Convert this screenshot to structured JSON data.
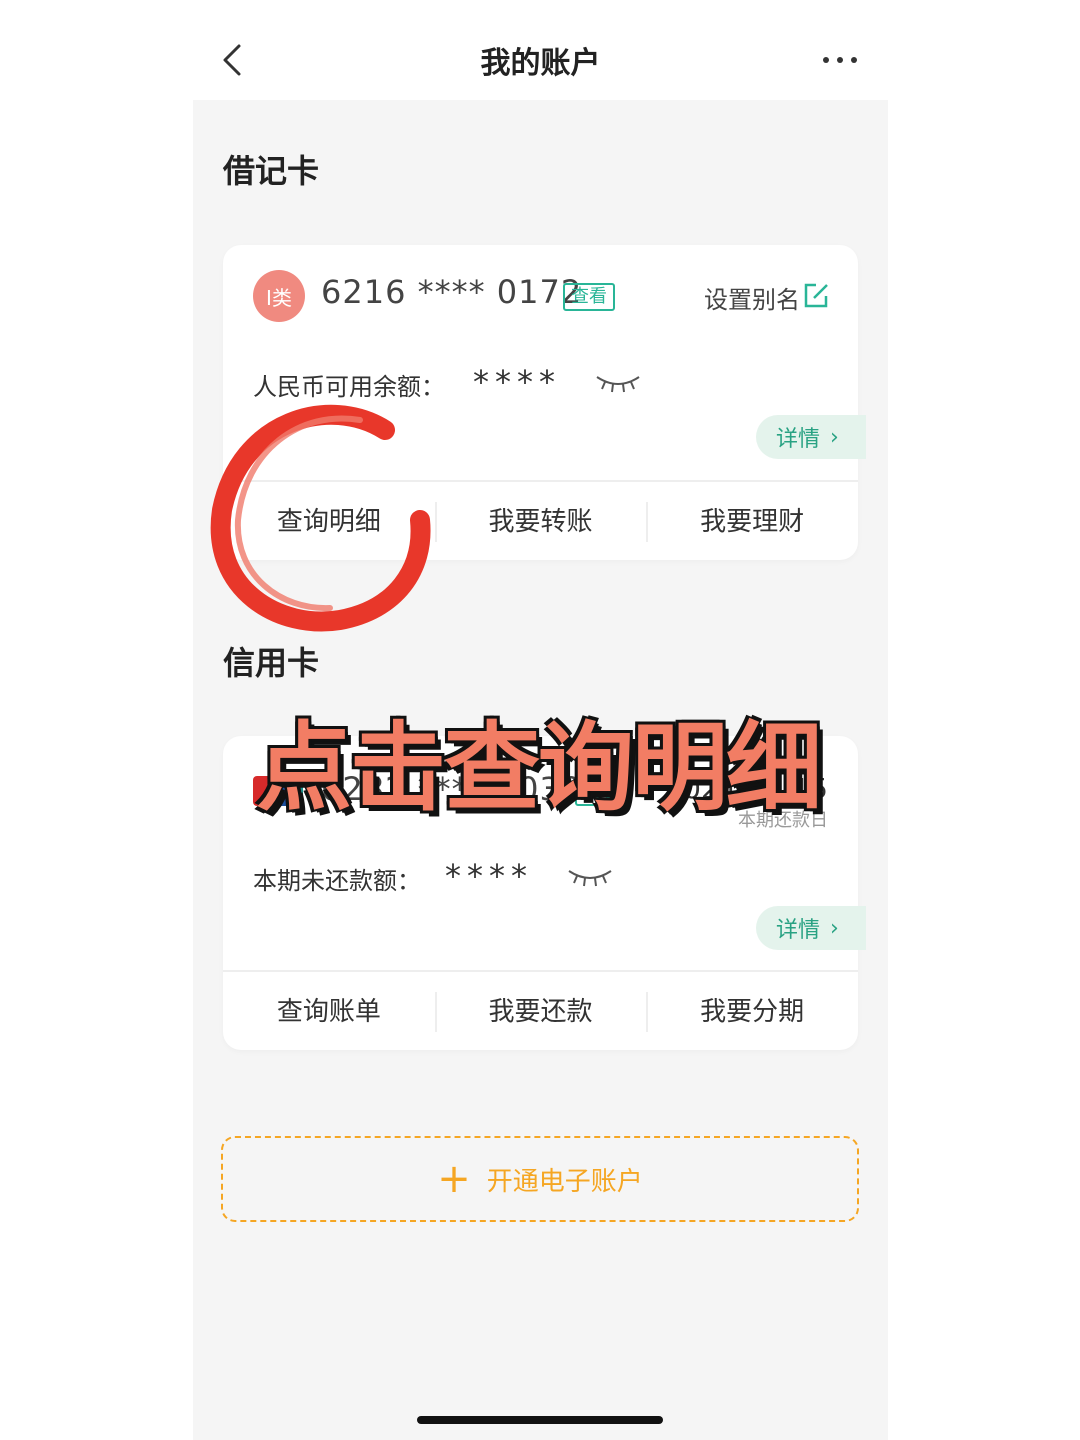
{
  "header": {
    "title": "我的账户"
  },
  "debit": {
    "section_title": "借记卡",
    "badge": "I类",
    "card_number": "6216 **** 0172",
    "view_tag": "查看",
    "alias_label": "设置别名",
    "balance_label": "人民币可用余额：",
    "balance_masked": "****",
    "detail_label": "详情",
    "actions": [
      "查询明细",
      "我要转账",
      "我要理财"
    ]
  },
  "credit": {
    "section_title": "信用卡",
    "card_number": "6282 **** 8030",
    "view_tag": "查看",
    "due_date": "2024-10-15",
    "due_label": "本期还款日",
    "balance_label": "本期未还款额：",
    "balance_masked": "****",
    "detail_label": "详情",
    "actions": [
      "查询账单",
      "我要还款",
      "我要分期"
    ]
  },
  "open_account": {
    "label": "开通电子账户"
  },
  "annotation": {
    "text": "点击查询明细"
  },
  "colors": {
    "accent_green": "#29b597",
    "accent_orange": "#f5a623",
    "annotation_red": "#e8372a"
  }
}
